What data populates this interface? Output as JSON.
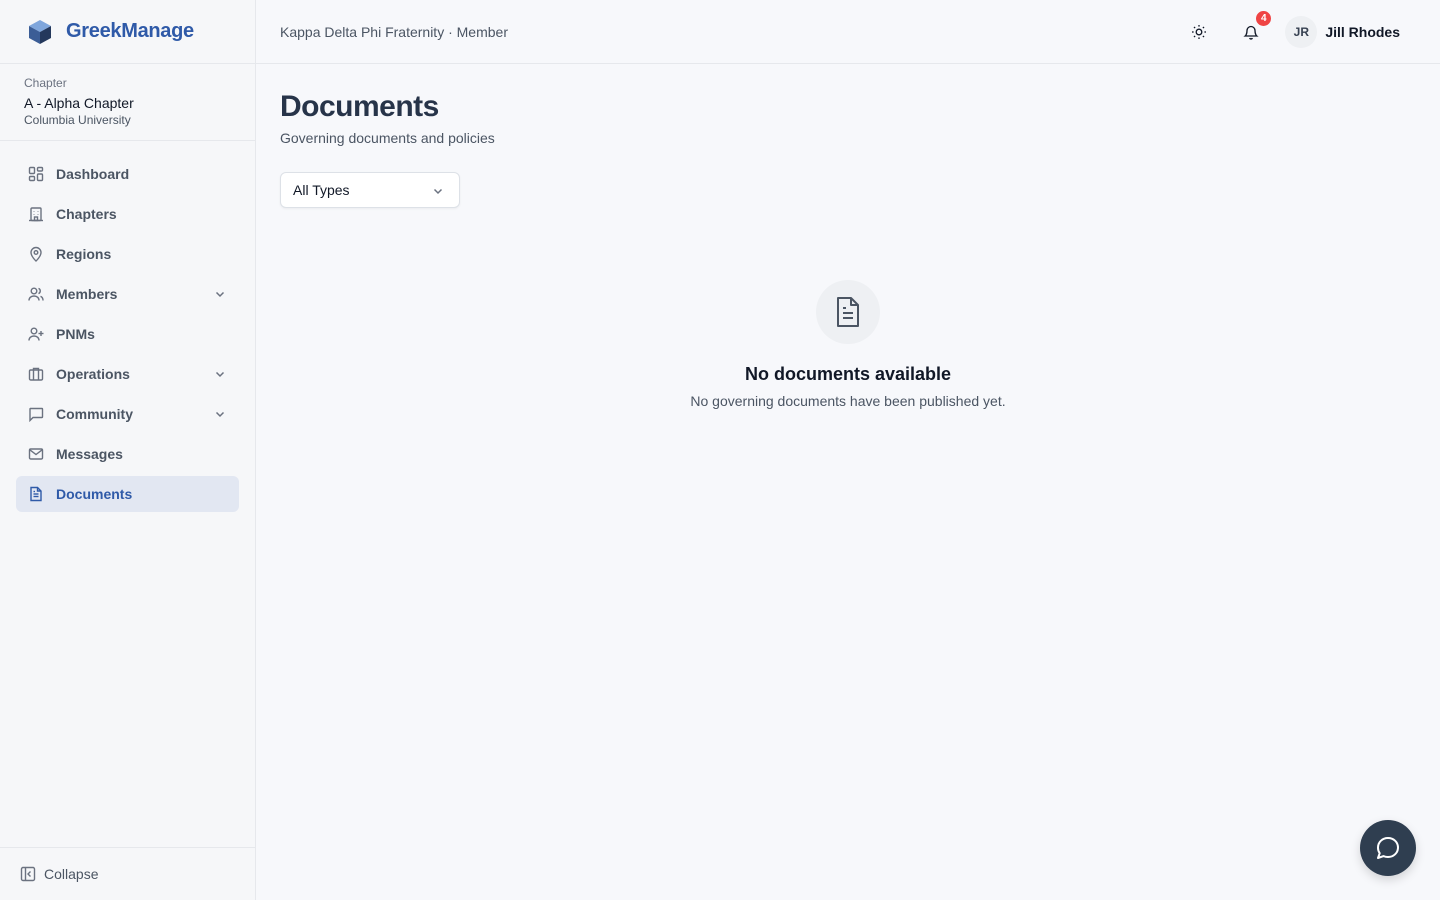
{
  "brand": {
    "name": "GreekManage",
    "logo_icon": "cube-logo-icon",
    "color": "#2f5aa8"
  },
  "chapter": {
    "label": "Chapter",
    "name": "A - Alpha Chapter",
    "university": "Columbia University"
  },
  "nav": {
    "items": [
      {
        "label": "Dashboard",
        "icon": "dashboard-grid-icon",
        "expandable": false,
        "active": false
      },
      {
        "label": "Chapters",
        "icon": "building-icon",
        "expandable": false,
        "active": false
      },
      {
        "label": "Regions",
        "icon": "map-pin-icon",
        "expandable": false,
        "active": false
      },
      {
        "label": "Members",
        "icon": "users-icon",
        "expandable": true,
        "active": false
      },
      {
        "label": "PNMs",
        "icon": "user-plus-icon",
        "expandable": false,
        "active": false
      },
      {
        "label": "Operations",
        "icon": "briefcase-icon",
        "expandable": true,
        "active": false
      },
      {
        "label": "Community",
        "icon": "chat-square-icon",
        "expandable": true,
        "active": false
      },
      {
        "label": "Messages",
        "icon": "mail-icon",
        "expandable": false,
        "active": false
      },
      {
        "label": "Documents",
        "icon": "document-icon",
        "expandable": false,
        "active": true
      }
    ],
    "collapse_label": "Collapse"
  },
  "header": {
    "org_line": "Kappa Delta Phi Fraternity · Member",
    "notifications_count": "4",
    "user_initials": "JR",
    "user_name": "Jill Rhodes"
  },
  "main": {
    "title": "Documents",
    "subtitle": "Governing documents and policies",
    "filter": {
      "selected": "All Types"
    },
    "empty_state": {
      "title": "No documents available",
      "message": "No governing documents have been published yet."
    }
  },
  "colors": {
    "accent": "#2f5aa8",
    "active_bg": "#e2e7f2",
    "badge": "#ef4444",
    "fab": "#2f3e50"
  }
}
